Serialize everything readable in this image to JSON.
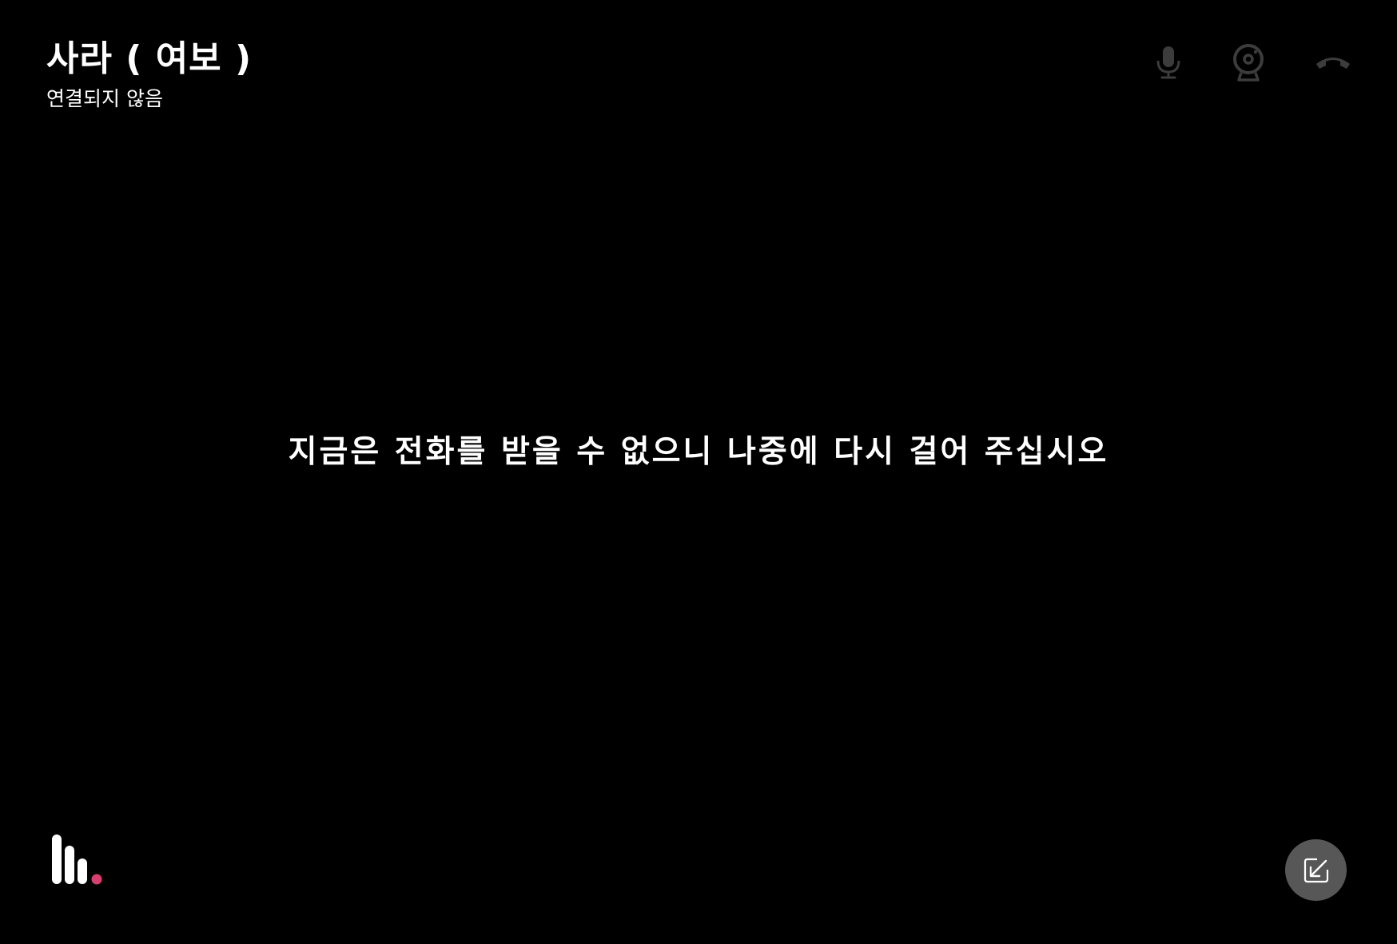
{
  "header": {
    "contact_name": "사라 ( 여보 )",
    "call_status": "연결되지 않음"
  },
  "controls": {
    "mic_icon": "microphone-icon",
    "camera_icon": "webcam-icon",
    "hangup_icon": "hang-up-phone-icon",
    "icon_color": "#3c3c3c"
  },
  "message": {
    "text": "지금은 전화를 받을 수 없으니 나중에 다시 걸어 주십시오"
  },
  "logo": {
    "icon": "app-logo-icon",
    "accent_color": "#d63f6e"
  },
  "minimize": {
    "icon": "minimize-arrow-icon",
    "background": "#575757"
  }
}
